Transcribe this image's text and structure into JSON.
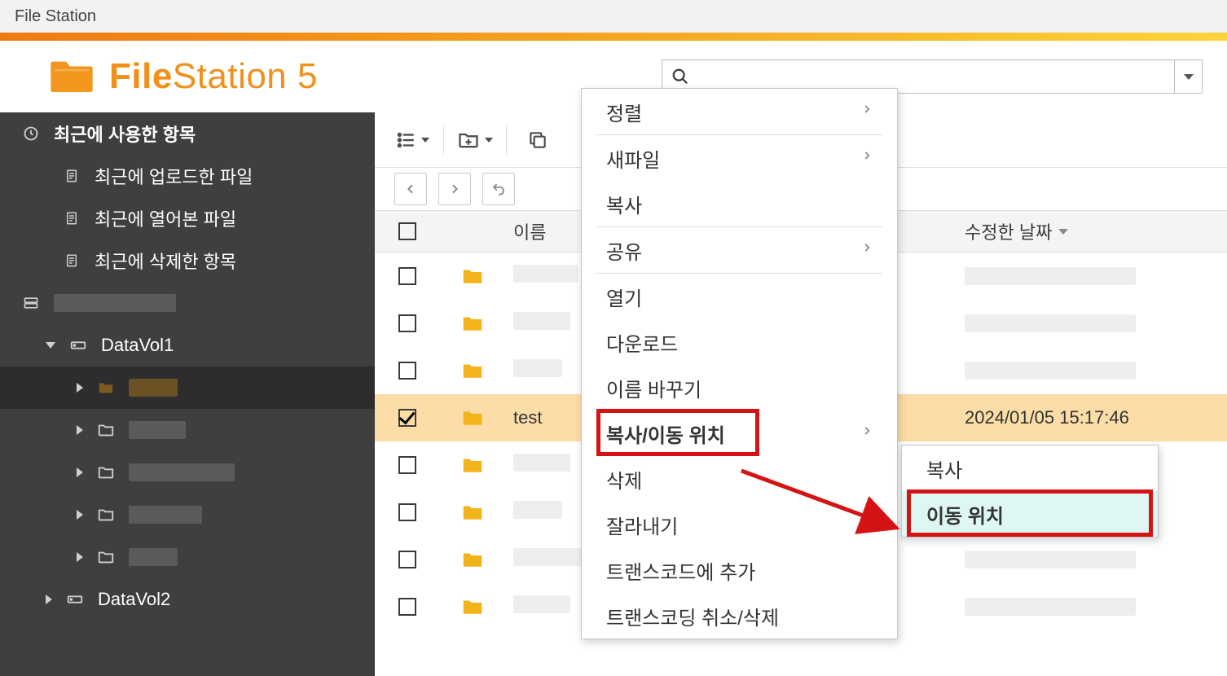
{
  "window": {
    "title": "File Station"
  },
  "app": {
    "name_bold": "File",
    "name_rest": "Station 5"
  },
  "search": {
    "placeholder": ""
  },
  "sidebar": {
    "recent_header": "최근에 사용한 항목",
    "recent_uploaded": "최근에 업로드한 파일",
    "recent_opened": "최근에 열어본 파일",
    "recent_deleted": "최근에 삭제한 항목",
    "vol1": "DataVol1",
    "vol2": "DataVol2"
  },
  "columns": {
    "name": "이름",
    "date": "수정한 날짜"
  },
  "rows": {
    "test_name": "test",
    "test_date": "2024/01/05 15:17:46"
  },
  "context_menu": {
    "sort": "정렬",
    "new_file": "새파일",
    "copy": "복사",
    "share": "공유",
    "open": "열기",
    "download": "다운로드",
    "rename": "이름 바꾸기",
    "copy_move_to": "복사/이동 위치",
    "delete": "삭제",
    "cut": "잘라내기",
    "add_transcode": "트랜스코드에 추가",
    "cancel_transcode": "트랜스코딩 취소/삭제"
  },
  "submenu": {
    "copy": "복사",
    "move_to": "이동 위치"
  }
}
